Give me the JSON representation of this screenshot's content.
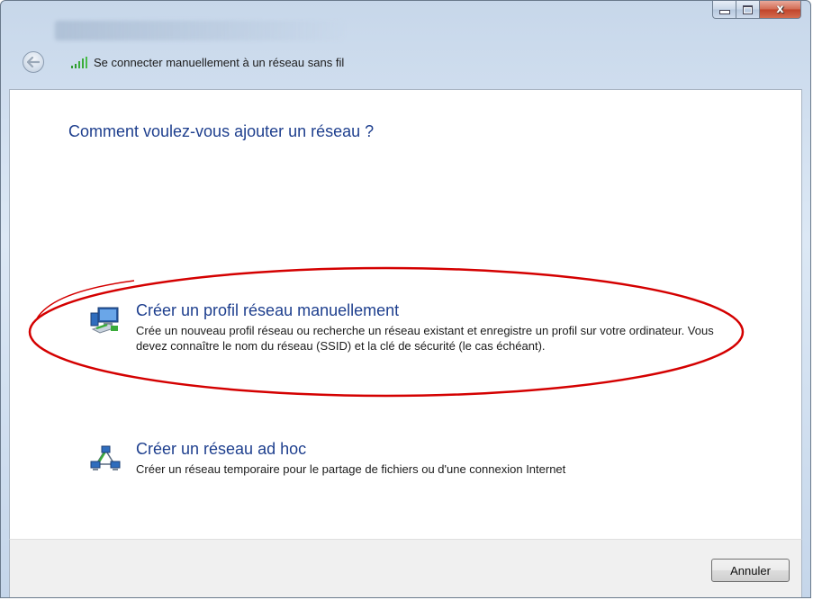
{
  "window": {
    "title": "Se connecter manuellement à un réseau sans fil",
    "caption_buttons": {
      "minimize_icon": "minimize-icon",
      "maximize_icon": "maximize-icon",
      "close_icon": "close-icon",
      "close_glyph": "x"
    },
    "back_icon": "back-arrow-icon",
    "signal_icon": "wireless-signal-icon"
  },
  "main": {
    "question": "Comment voulez-vous ajouter un réseau ?",
    "options": [
      {
        "title": "Créer un profil réseau manuellement",
        "description": "Crée un nouveau profil réseau ou recherche un réseau existant et enregistre un profil sur votre ordinateur. Vous devez connaître le nom du réseau (SSID) et la clé de sécurité (le cas échéant).",
        "icon": "network-computer-icon",
        "highlighted": true
      },
      {
        "title": "Créer un réseau ad hoc",
        "description": "Créer un réseau temporaire pour le partage de fichiers ou d'une connexion Internet",
        "icon": "adhoc-network-icon",
        "highlighted": false
      }
    ]
  },
  "footer": {
    "cancel_label": "Annuler"
  },
  "colors": {
    "heading_blue": "#1e3f8e",
    "highlight_red": "#d40000",
    "close_red": "#c0432a"
  }
}
